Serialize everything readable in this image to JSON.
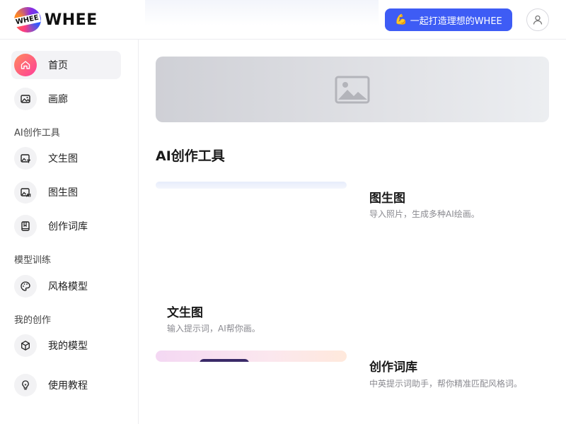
{
  "header": {
    "logo_text": "WHEE",
    "logo_badge": "WHEE",
    "cta_emoji": "💪",
    "cta_label": "一起打造理想的WHEE"
  },
  "sidebar": {
    "items": [
      {
        "label": "首页",
        "icon": "home-icon"
      },
      {
        "label": "画廊",
        "icon": "gallery-icon"
      }
    ],
    "sections": [
      {
        "title": "AI创作工具",
        "items": [
          {
            "label": "文生图",
            "icon": "text-to-image-icon"
          },
          {
            "label": "图生图",
            "icon": "image-to-image-icon"
          },
          {
            "label": "创作词库",
            "icon": "prompt-library-icon"
          }
        ]
      },
      {
        "title": "模型训练",
        "items": [
          {
            "label": "风格模型",
            "icon": "palette-icon"
          }
        ]
      },
      {
        "title": "我的创作",
        "items": [
          {
            "label": "我的模型",
            "icon": "cube-icon"
          }
        ]
      }
    ],
    "footer_item": {
      "label": "使用教程",
      "icon": "lightbulb-icon"
    }
  },
  "main": {
    "section_title": "AI创作工具",
    "cards": [
      {
        "title": "图生图",
        "desc": "导入照片，生成多种AI绘画。"
      },
      {
        "title": "文生图",
        "desc": "输入提示词，AI帮你画。"
      },
      {
        "title": "创作词库",
        "desc": "中英提示词助手，帮你精准匹配风格词。"
      }
    ]
  },
  "colors": {
    "accent": "#3e5cf5",
    "active_icon_gradient_start": "#ff8a5c",
    "active_icon_gradient_end": "#ff3d9a",
    "muted_text": "#8a8a90"
  }
}
